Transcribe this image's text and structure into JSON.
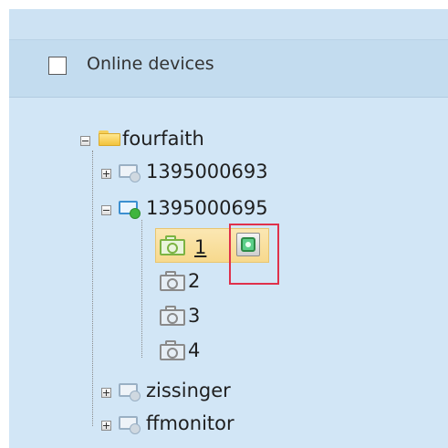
{
  "header": {
    "label": "Online devices",
    "checked": false
  },
  "tree": {
    "root": {
      "label": "fourfaith",
      "expanded": true
    },
    "devices": [
      {
        "label": "1395000693",
        "expanded": false,
        "online": false
      },
      {
        "label": "1395000695",
        "expanded": true,
        "online": true,
        "channels": [
          {
            "label": "1",
            "selected": true,
            "state": "playing"
          },
          {
            "label": "2"
          },
          {
            "label": "3"
          },
          {
            "label": "4"
          }
        ]
      },
      {
        "label": "zissinger",
        "expanded": false,
        "online": false
      },
      {
        "label": "ffmonitor",
        "expanded": false,
        "online": false
      }
    ]
  },
  "colors": {
    "panel_bg": "#d2e6f6",
    "header_bg": "#c3dcef",
    "selection": "#f7d98d",
    "highlight": "#e0314b",
    "online": "#3fb53f"
  },
  "icons": {
    "root": "folder-icon",
    "device": "device-icon",
    "channel": "camera-icon",
    "play": "play-video-icon"
  }
}
